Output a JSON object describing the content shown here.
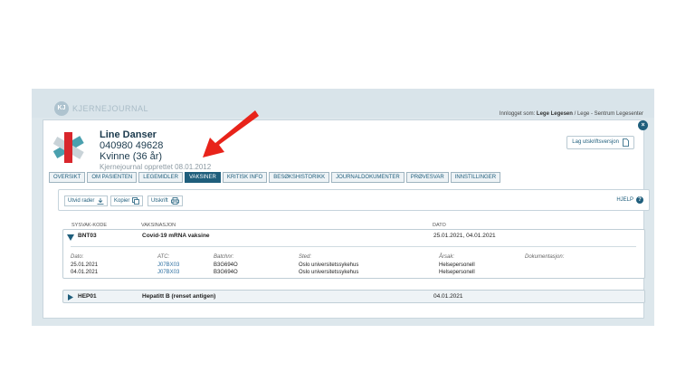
{
  "app": {
    "name": "KJERNEJOURNAL",
    "logo_text": "KJ"
  },
  "login": {
    "prefix": "Innlogget som:",
    "user": "Lege Legesen",
    "rest": "/ Lege - Sentrum Legesenter"
  },
  "patient": {
    "name": "Line Danser",
    "id": "040980 49628",
    "gender_age": "Kvinne (36 år)",
    "journal_created": "Kjernejournal opprettet 08.01.2012"
  },
  "print_version_label": "Lag utskriftsversjon",
  "tabs": [
    {
      "label": "OVERSIKT",
      "active": false
    },
    {
      "label": "OM PASIENTEN",
      "active": false
    },
    {
      "label": "LEGEMIDLER",
      "active": false
    },
    {
      "label": "VAKSINER",
      "active": true
    },
    {
      "label": "KRITISK INFO",
      "active": false
    },
    {
      "label": "BESØKSHISTORIKK",
      "active": false
    },
    {
      "label": "JOURNALDOKUMENTER",
      "active": false
    },
    {
      "label": "PRØVESVAR",
      "active": false
    },
    {
      "label": "INNSTILLINGER",
      "active": false
    }
  ],
  "toolbar": {
    "expand_label": "Utvid rader",
    "copy_label": "Kopier",
    "print_label": "Utskrift",
    "help_label": "HJELP"
  },
  "columns": {
    "code": "SYSVAK-KODE",
    "vaccination": "VAKSINASJON",
    "date": "DATO"
  },
  "vaccines": [
    {
      "code": "BNT03",
      "name": "Covid-19 mRNA vaksine",
      "dates": "25.01.2021, 04.01.2021",
      "expanded": true,
      "detail_headers": {
        "date": "Dato:",
        "atc": "ATC:",
        "batch": "Batchnr:",
        "place": "Sted:",
        "reason": "Årsak:",
        "doc": "Dokumentasjon:"
      },
      "doses": [
        {
          "date": "25.01.2021",
          "atc": "J07BX03",
          "batch": "B3G694O",
          "place": "Oslo universitetssykehus",
          "reason": "Helsepersonell"
        },
        {
          "date": "04.01.2021",
          "atc": "J07BX03",
          "batch": "B3G694O",
          "place": "Oslo universitetssykehus",
          "reason": "Helsepersonell"
        }
      ]
    },
    {
      "code": "HEP01",
      "name": "Hepatitt B (renset antigen)",
      "dates": "04.01.2021",
      "expanded": false
    }
  ],
  "colors": {
    "accent": "#1f5e7c",
    "arrow": "#e8231a",
    "logo_red": "#d9262c",
    "logo_teal": "#2a8fa0"
  }
}
